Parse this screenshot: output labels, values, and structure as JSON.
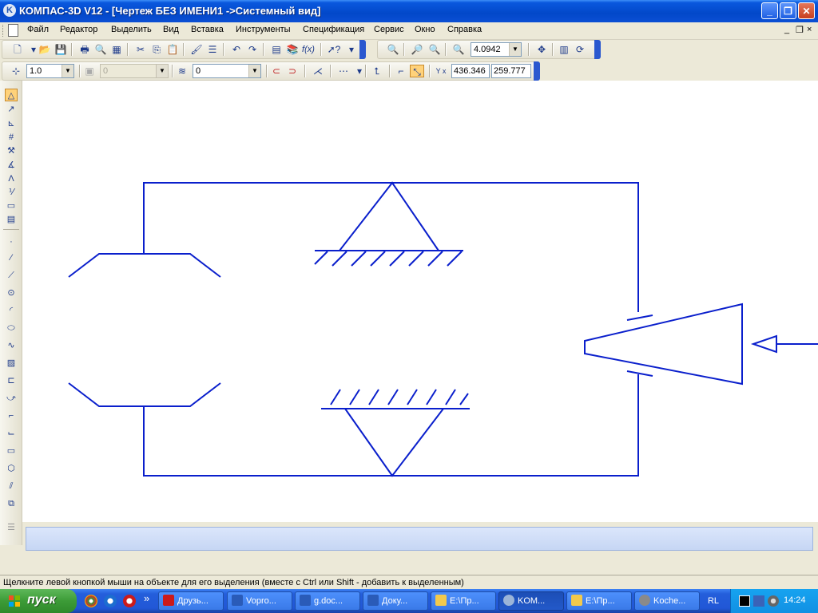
{
  "window": {
    "app_icon_glyph": "K",
    "title": "КОМПАС-3D V12 - [Чертеж БЕЗ ИМЕНИ1 ->Системный вид]",
    "minimize_glyph": "_",
    "restore_glyph": "❐",
    "close_glyph": "✕"
  },
  "menu": {
    "items": [
      "Файл",
      "Редактор",
      "Выделить",
      "Вид",
      "Вставка",
      "Инструменты",
      "Спецификация",
      "Сервис",
      "Окно",
      "Справка"
    ],
    "mdi_controls": [
      "_",
      "❐",
      "×"
    ]
  },
  "toolbar_standard": {
    "zoom_value": "4.0942"
  },
  "toolbar_current": {
    "step_value": "1.0",
    "layer_value": "0",
    "style_value": "0",
    "coord_label": "Y x",
    "coord_x": "436.346",
    "coord_y": "259.777"
  },
  "status": {
    "message": "Щелкните левой кнопкой мыши на объекте для его выделения (вместе с Ctrl или Shift - добавить к выделенным)"
  },
  "taskbar": {
    "start_label": "пуск",
    "overflow_glyph": "»",
    "tasks": [
      {
        "label": "Друзь...",
        "color": "#cc1a1a"
      },
      {
        "label": "Vopro...",
        "color": "#2a5bb8"
      },
      {
        "label": "g.doc...",
        "color": "#2a5bb8"
      },
      {
        "label": "Доку...",
        "color": "#2a5bb8"
      },
      {
        "label": "E:\\Пр...",
        "color": "#f2c94c"
      },
      {
        "label": "KOM...",
        "color": "#9bb4d8"
      },
      {
        "label": "E:\\Пр...",
        "color": "#f2c94c"
      },
      {
        "label": "Koche...",
        "color": "#8a8a8a"
      }
    ],
    "language": "RL",
    "clock": "14:24"
  },
  "colors": {
    "drawing_line": "#0a1fcc",
    "canvas_bg": "#ffffff"
  }
}
